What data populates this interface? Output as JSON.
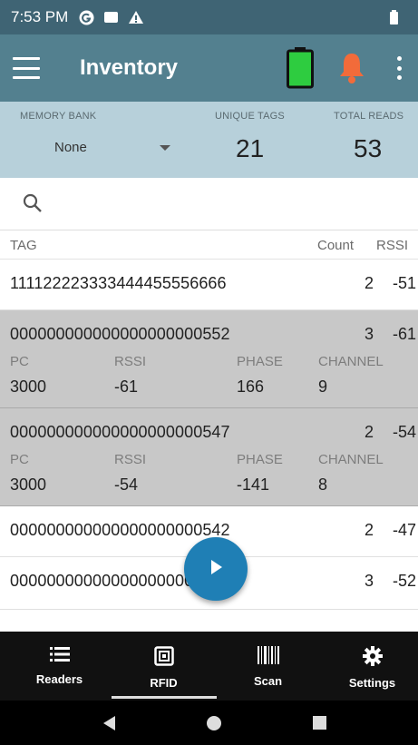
{
  "status": {
    "time": "7:53 PM",
    "icons": [
      "g-circle-icon",
      "message-icon",
      "warning-icon",
      "battery-icon"
    ]
  },
  "app_bar": {
    "title": "Inventory",
    "battery_color": "#2ecc40",
    "bell_color": "#f26b3a"
  },
  "stats": {
    "memory_bank_label": "MEMORY BANK",
    "memory_bank_value": "None",
    "unique_tags_label": "UNIQUE TAGS",
    "unique_tags_value": "21",
    "total_reads_label": "TOTAL READS",
    "total_reads_value": "53"
  },
  "table": {
    "headers": {
      "tag": "TAG",
      "count": "Count",
      "rssi": "RSSI"
    },
    "detail_labels": {
      "pc": "PC",
      "rssi": "RSSI",
      "phase": "PHASE",
      "channel": "CHANNEL"
    },
    "rows": [
      {
        "tag": "111122223333444455556666",
        "count": "2",
        "rssi": "-51"
      },
      {
        "tag": "000000000000000000000552",
        "count": "3",
        "rssi": "-61",
        "pc": "3000",
        "d_rssi": "-61",
        "phase": "166",
        "channel": "9"
      },
      {
        "tag": "000000000000000000000547",
        "count": "2",
        "rssi": "-54",
        "pc": "3000",
        "d_rssi": "-54",
        "phase": "-141",
        "channel": "8"
      },
      {
        "tag": "000000000000000000000542",
        "count": "2",
        "rssi": "-47"
      },
      {
        "tag": "000000000000000000000539",
        "count": "3",
        "rssi": "-52"
      }
    ]
  },
  "nav": {
    "items": [
      {
        "label": "Readers",
        "icon": "list-icon"
      },
      {
        "label": "RFID",
        "icon": "rfid-icon"
      },
      {
        "label": "Scan",
        "icon": "barcode-icon"
      },
      {
        "label": "Settings",
        "icon": "gear-icon"
      }
    ]
  }
}
